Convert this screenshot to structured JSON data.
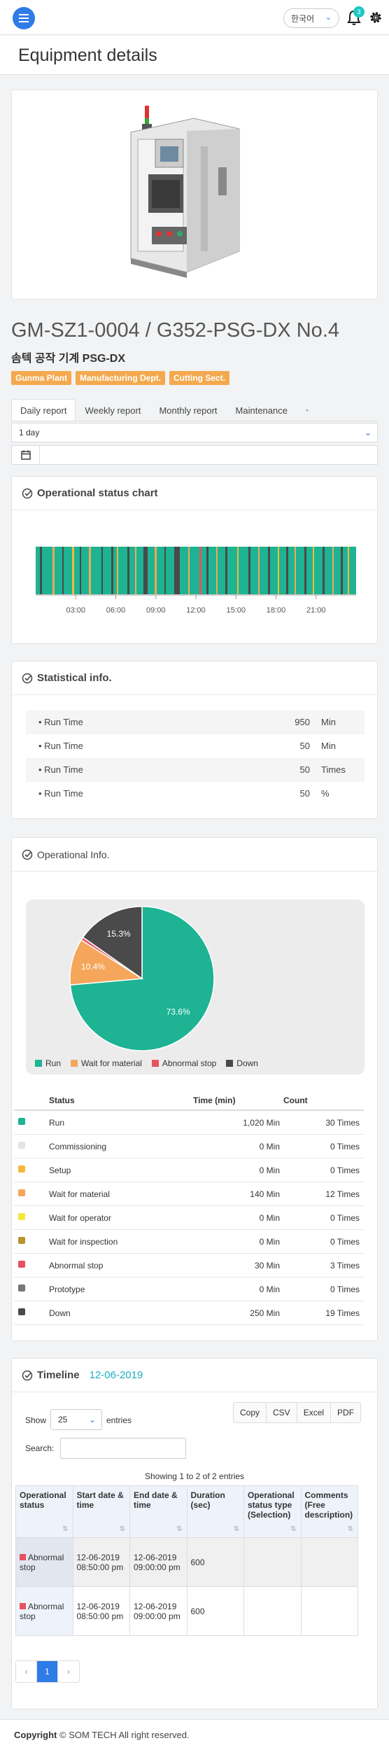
{
  "header": {
    "language": "한국어",
    "notification_count": "3"
  },
  "page_title": "Equipment details",
  "equipment": {
    "title": "GM-SZ1-0004 / G352-PSG-DX No.4",
    "subtitle": "솜텍 공작 기계 PSG-DX",
    "tags": [
      "Gunma Plant",
      "Manufacturing Dept.",
      "Cutting Sect."
    ]
  },
  "tabs": [
    "Daily report",
    "Weekly report",
    "Monthly report",
    "Maintenance"
  ],
  "period_select": "1 day",
  "status_chart": {
    "title": "Operational status chart",
    "ticks": [
      "03:00",
      "06:00",
      "09:00",
      "12:00",
      "15:00",
      "18:00",
      "21:00"
    ]
  },
  "statistical": {
    "title": "Statistical info.",
    "rows": [
      {
        "label": "Run Time",
        "value": "950",
        "unit": "Min"
      },
      {
        "label": "Run Time",
        "value": "50",
        "unit": "Min"
      },
      {
        "label": "Run Time",
        "value": "50",
        "unit": "Times"
      },
      {
        "label": "Run Time",
        "value": "50",
        "unit": "%"
      }
    ]
  },
  "operational": {
    "title": "Operational Info.",
    "columns": [
      "Status",
      "Time (min)",
      "Count"
    ],
    "rows": [
      {
        "status": "Run",
        "time": "1,020 Min",
        "count": "30 Times",
        "color": "#1db393"
      },
      {
        "status": "Commissioning",
        "time": "0 Min",
        "count": "0 Times",
        "color": "#e4e4e4"
      },
      {
        "status": "Setup",
        "time": "0 Min",
        "count": "0 Times",
        "color": "#f3b93a"
      },
      {
        "status": "Wait for material",
        "time": "140 Min",
        "count": "12 Times",
        "color": "#f5a65b"
      },
      {
        "status": "Wait for operator",
        "time": "0 Min",
        "count": "0 Times",
        "color": "#f3e83a"
      },
      {
        "status": "Wait for inspection",
        "time": "0 Min",
        "count": "0 Times",
        "color": "#b8932e"
      },
      {
        "status": "Abnormal stop",
        "time": "30 Min",
        "count": "3 Times",
        "color": "#e8525e"
      },
      {
        "status": "Prototype",
        "time": "0 Min",
        "count": "0 Times",
        "color": "#777777"
      },
      {
        "status": "Down",
        "time": "250 Min",
        "count": "19 Times",
        "color": "#4a4a4a"
      }
    ]
  },
  "chart_data": {
    "type": "pie",
    "categories": [
      "Run",
      "Wait for material",
      "Abnormal stop",
      "Down"
    ],
    "values": [
      73.6,
      10.4,
      0.7,
      15.3
    ],
    "labels": [
      "73.6%",
      "10.4%",
      "",
      "15.3%"
    ],
    "colors": [
      "#1db393",
      "#f5a65b",
      "#e8525e",
      "#4a4a4a"
    ],
    "legend": "bottom"
  },
  "timeline": {
    "title": "Timeline",
    "date": "12-06-2019",
    "show_label": "Show",
    "entries_value": "25",
    "entries_label": "entries",
    "buttons": [
      "Copy",
      "CSV",
      "Excel",
      "PDF"
    ],
    "search_label": "Search:",
    "info": "Showing 1 to 2 of 2 entries",
    "columns": [
      "Operational status",
      "Start date & time",
      "End date & time",
      "Duration (sec)",
      "Operational status type (Selection)",
      "Comments (Free description)"
    ],
    "rows": [
      {
        "status": "Abnormal stop",
        "start": "12-06-2019 08:50:00 pm",
        "end": "12-06-2019 09:00:00 pm",
        "duration": "600",
        "type": "",
        "comment": ""
      },
      {
        "status": "Abnormal stop",
        "start": "12-06-2019 08:50:00 pm",
        "end": "12-06-2019 09:00:00 pm",
        "duration": "600",
        "type": "",
        "comment": ""
      }
    ],
    "pages": [
      "‹",
      "1",
      "›"
    ]
  },
  "footer": {
    "bold": "Copyright",
    "text": "© SOM TECH All right reserved."
  }
}
